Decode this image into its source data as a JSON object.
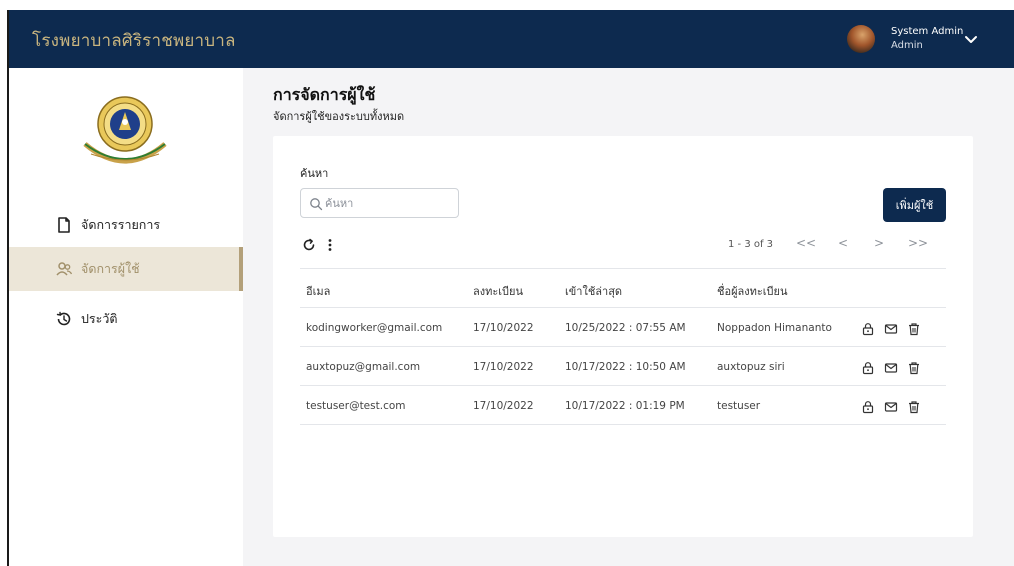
{
  "app": {
    "title": "โรงพยาบาลศิริราชพยาบาล"
  },
  "user": {
    "name": "System Admin",
    "role": "Admin"
  },
  "sidebar": {
    "items": [
      {
        "label": "จัดการรายการ",
        "icon": "file-icon",
        "active": false
      },
      {
        "label": "จัดการผู้ใช้",
        "icon": "users-icon",
        "active": true
      },
      {
        "label": "ประวัติ",
        "icon": "history-icon",
        "active": false
      }
    ]
  },
  "page": {
    "title": "การจัดการผู้ใช้",
    "subtitle": "จัดการผู้ใช้ของระบบทั้งหมด"
  },
  "search": {
    "label": "ค้นหา",
    "placeholder": "ค้นหา",
    "value": ""
  },
  "add_button": {
    "label": "เพิ่มผู้ใช้"
  },
  "pagination": {
    "summary": "1 - 3 of 3",
    "first": "<<",
    "prev": "<",
    "next": ">",
    "last": ">>"
  },
  "table": {
    "headers": [
      "อีเมล",
      "ลงทะเบียน",
      "เข้าใช้ล่าสุด",
      "ชื่อผู้ลงทะเบียน"
    ],
    "rows": [
      {
        "email": "kodingworker@gmail.com",
        "registered": "17/10/2022",
        "last_login": "10/25/2022 : 07:55 AM",
        "registrant": "Noppadon Himananto"
      },
      {
        "email": "auxtopuz@gmail.com",
        "registered": "17/10/2022",
        "last_login": "10/17/2022 : 10:50 AM",
        "registrant": "auxtopuz siri"
      },
      {
        "email": "testuser@test.com",
        "registered": "17/10/2022",
        "last_login": "10/17/2022 : 01:19 PM",
        "registrant": "testuser"
      }
    ]
  },
  "colors": {
    "topbar": "#0d2a4f",
    "accent": "#c9b57f",
    "active_bg": "#ece6d8",
    "active_text": "#a1906a",
    "button": "#0d2a4f"
  }
}
